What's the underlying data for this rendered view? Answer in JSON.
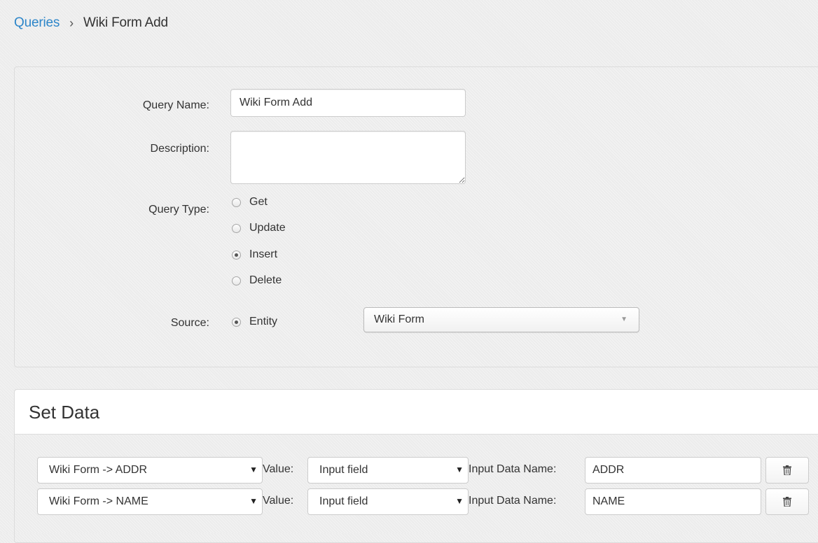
{
  "breadcrumb": {
    "parent": "Queries",
    "separator": "›",
    "current": "Wiki Form Add"
  },
  "form": {
    "query_name_label": "Query Name:",
    "query_name_value": "Wiki Form Add",
    "description_label": "Description:",
    "description_value": "",
    "query_type_label": "Query Type:",
    "query_types": [
      {
        "label": "Get",
        "checked": false
      },
      {
        "label": "Update",
        "checked": false
      },
      {
        "label": "Insert",
        "checked": true
      },
      {
        "label": "Delete",
        "checked": false
      }
    ],
    "source_label": "Source:",
    "source_option": "Entity",
    "entity_select_value": "Wiki Form"
  },
  "set_data": {
    "title": "Set Data",
    "value_label": "Value:",
    "input_data_name_label": "Input Data Name:",
    "rows": [
      {
        "field": "Wiki Form -> ADDR",
        "value": "Input field",
        "input_data_name": "ADDR"
      },
      {
        "field": "Wiki Form -> NAME",
        "value": "Input field",
        "input_data_name": "NAME"
      }
    ]
  },
  "icons": {
    "select_arrow": "chevron-down-icon",
    "caret": "caret-down-icon",
    "delete": "trash-icon"
  },
  "colors": {
    "link": "#2e86c9",
    "background": "#ececec"
  }
}
